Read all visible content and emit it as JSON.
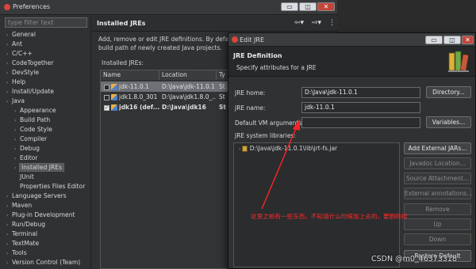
{
  "preferences": {
    "title": "Preferences",
    "filter_placeholder": "type filter text",
    "tree": [
      {
        "label": "General",
        "level": 0,
        "twisty": true
      },
      {
        "label": "Ant",
        "level": 0,
        "twisty": true
      },
      {
        "label": "C/C++",
        "level": 0,
        "twisty": true
      },
      {
        "label": "CodeTogether",
        "level": 0,
        "twisty": true
      },
      {
        "label": "DevStyle",
        "level": 0,
        "twisty": true
      },
      {
        "label": "Help",
        "level": 0,
        "twisty": true
      },
      {
        "label": "Install/Update",
        "level": 0,
        "twisty": true
      },
      {
        "label": "Java",
        "level": 0,
        "twisty": true
      },
      {
        "label": "Appearance",
        "level": 1,
        "twisty": true
      },
      {
        "label": "Build Path",
        "level": 1,
        "twisty": true
      },
      {
        "label": "Code Style",
        "level": 1,
        "twisty": true
      },
      {
        "label": "Compiler",
        "level": 1,
        "twisty": true
      },
      {
        "label": "Debug",
        "level": 1,
        "twisty": true
      },
      {
        "label": "Editor",
        "level": 1,
        "twisty": true
      },
      {
        "label": "Installed JREs",
        "level": 1,
        "twisty": true,
        "selected": true
      },
      {
        "label": "JUnit",
        "level": 1,
        "twisty": false
      },
      {
        "label": "Properties Files Editor",
        "level": 1,
        "twisty": false
      },
      {
        "label": "Language Servers",
        "level": 0,
        "twisty": true
      },
      {
        "label": "Maven",
        "level": 0,
        "twisty": true
      },
      {
        "label": "Plug-in Development",
        "level": 0,
        "twisty": true
      },
      {
        "label": "Run/Debug",
        "level": 0,
        "twisty": true
      },
      {
        "label": "Terminal",
        "level": 0,
        "twisty": true
      },
      {
        "label": "TextMate",
        "level": 0,
        "twisty": true
      },
      {
        "label": "Tools",
        "level": 0,
        "twisty": true
      },
      {
        "label": "Version Control (Team)",
        "level": 0,
        "twisty": true
      }
    ],
    "page_title": "Installed JREs",
    "description_line1": "Add, remove or edit JRE definitions. By defa",
    "description_line2": "build path of newly created Java projects.",
    "jres_label": "Installed JREs:",
    "columns": [
      "Name",
      "Location",
      "Ty"
    ],
    "jres": [
      {
        "name": "jdk-11.0.1",
        "location": "D:\\Java\\jdk-11.0.1",
        "type": "St",
        "checked": false,
        "highlight": true,
        "bold": false
      },
      {
        "name": "jdk1.8.0_301",
        "location": "D:\\Java\\jdk1.8.0_...",
        "type": "St",
        "checked": false,
        "highlight": false,
        "bold": false
      },
      {
        "name": "jdk16 (def...",
        "location": "D:\\Java\\jdk16",
        "type": "St",
        "checked": true,
        "highlight": false,
        "bold": true
      }
    ]
  },
  "edit_jre": {
    "title": "Edit JRE",
    "section_title": "JRE Definition",
    "section_subtitle": "Specify attributes for a JRE",
    "home_label": "JRE home:",
    "home_value": "D:\\Java\\jdk-11.0.1",
    "directory_button": "Directory...",
    "name_label": "JRE name:",
    "name_value": "jdk-11.0.1",
    "vm_args_label": "Default VM arguments:",
    "vm_args_value": "",
    "variables_button": "Variables...",
    "libraries_label": "JRE system libraries:",
    "library_item": "D:\\Java\\jdk-11.0.1\\lib\\jrt-fs.jar",
    "buttons": {
      "add_external": "Add External JARs...",
      "javadoc": "Javadoc Location...",
      "source": "Source Attachment...",
      "annotations": "External annotations...",
      "remove": "Remove",
      "up": "Up",
      "down": "Down",
      "restore": "Restore Default"
    }
  },
  "annotation_text": "这里之前有一些东西，不知道什么时候加上去的，要删除掉",
  "watermark": "CSDN @m0_46373318",
  "colors": {
    "accent_red": "#ff2a2a",
    "selection": "#6d7075"
  }
}
